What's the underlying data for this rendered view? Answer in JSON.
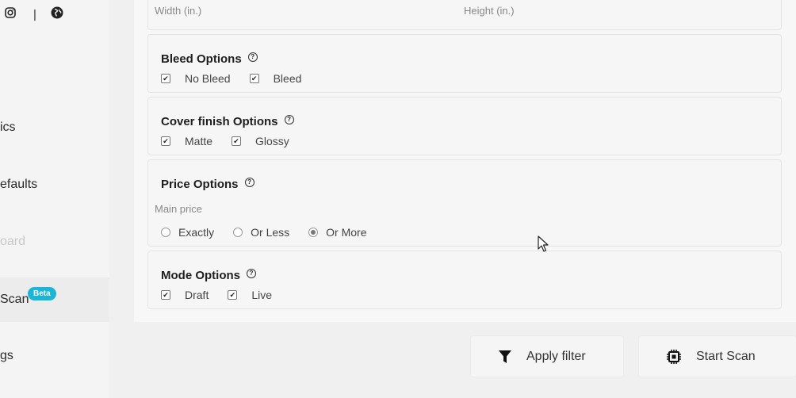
{
  "sidebar": {
    "items": [
      {
        "label": "ics"
      },
      {
        "label": "efaults"
      },
      {
        "label": "oard"
      },
      {
        "label": "Scan",
        "badge": "Beta"
      },
      {
        "label": "gs"
      }
    ],
    "social": {
      "separator": "|"
    }
  },
  "dimensions": {
    "width_label": "Width (in.)",
    "height_label": "Height (in.)"
  },
  "bleed": {
    "title": "Bleed Options",
    "help": "?",
    "options": [
      {
        "label": "No Bleed",
        "checked": true
      },
      {
        "label": "Bleed",
        "checked": true
      }
    ]
  },
  "cover": {
    "title": "Cover finish Options",
    "help": "?",
    "options": [
      {
        "label": "Matte",
        "checked": true
      },
      {
        "label": "Glossy",
        "checked": true
      }
    ]
  },
  "price": {
    "title": "Price Options",
    "help": "?",
    "sublabel": "Main price",
    "options": [
      {
        "label": "Exactly",
        "selected": false
      },
      {
        "label": "Or Less",
        "selected": false
      },
      {
        "label": "Or More",
        "selected": true
      }
    ]
  },
  "mode": {
    "title": "Mode Options",
    "help": "?",
    "options": [
      {
        "label": "Draft",
        "checked": true
      },
      {
        "label": "Live",
        "checked": true
      }
    ]
  },
  "actions": {
    "apply_filter": "Apply filter",
    "start_scan": "Start Scan"
  },
  "check_mark": "✔",
  "colors": {
    "beta_badge": "#1ab6d8",
    "background": "#f0f0f0"
  }
}
